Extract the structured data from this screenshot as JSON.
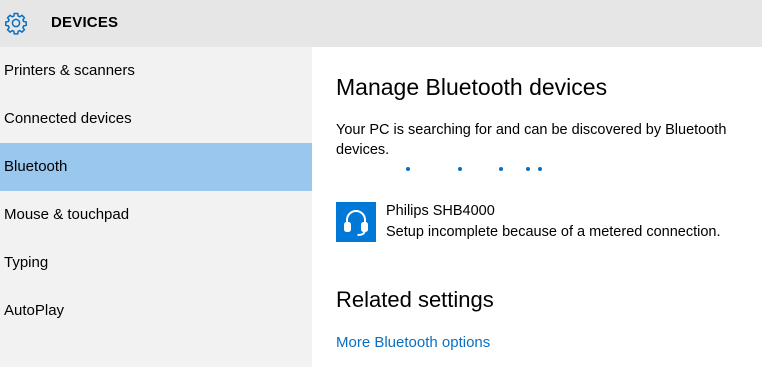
{
  "header": {
    "title": "DEVICES",
    "icon": "gear-icon"
  },
  "sidebar": {
    "items": [
      {
        "label": "Printers & scanners",
        "selected": false
      },
      {
        "label": "Connected devices",
        "selected": false
      },
      {
        "label": "Bluetooth",
        "selected": true
      },
      {
        "label": "Mouse & touchpad",
        "selected": false
      },
      {
        "label": "Typing",
        "selected": false
      },
      {
        "label": "AutoPlay",
        "selected": false
      }
    ]
  },
  "main": {
    "title": "Manage Bluetooth devices",
    "description": "Your PC is searching for and can be discovered by Bluetooth devices.",
    "device": {
      "icon": "headset-icon",
      "name": "Philips SHB4000",
      "status": "Setup incomplete because of a metered connection."
    },
    "related_title": "Related settings",
    "link": "More Bluetooth options"
  },
  "colors": {
    "accent": "#0078d7",
    "selected": "#99c7ed",
    "header_bg": "#e6e6e6",
    "sidebar_bg": "#f2f2f2",
    "link": "#0a6fc2"
  }
}
